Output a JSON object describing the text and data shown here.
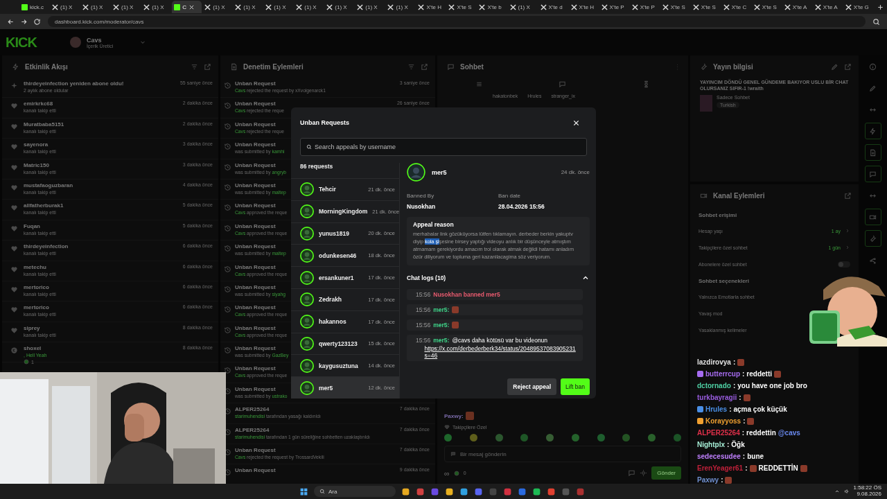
{
  "browser": {
    "tabs": [
      {
        "label": "kick.c",
        "kind": "kick",
        "selected": false
      },
      {
        "label": "(1) X",
        "kind": "x",
        "selected": false
      },
      {
        "label": "(1) X",
        "kind": "x",
        "selected": false
      },
      {
        "label": "(1) X",
        "kind": "x",
        "selected": false
      },
      {
        "label": "(1) X",
        "kind": "x",
        "selected": false
      },
      {
        "label": "C",
        "kind": "kick",
        "selected": true
      },
      {
        "label": "(1) X",
        "kind": "x",
        "selected": false
      },
      {
        "label": "(1) X",
        "kind": "x",
        "selected": false
      },
      {
        "label": "(1) X",
        "kind": "x",
        "selected": false
      },
      {
        "label": "(1) X",
        "kind": "x",
        "selected": false
      },
      {
        "label": "(1) X",
        "kind": "x",
        "selected": false
      },
      {
        "label": "(1) X",
        "kind": "x",
        "selected": false
      },
      {
        "label": "(1) X",
        "kind": "x",
        "selected": false
      },
      {
        "label": "X'te H",
        "kind": "x",
        "selected": false
      },
      {
        "label": "X'te S",
        "kind": "x",
        "selected": false
      },
      {
        "label": "X'te b",
        "kind": "x",
        "selected": false
      },
      {
        "label": "(1) X",
        "kind": "x",
        "selected": false
      },
      {
        "label": "X'te d",
        "kind": "x",
        "selected": false
      },
      {
        "label": "X'te H",
        "kind": "x",
        "selected": false
      },
      {
        "label": "X'te P",
        "kind": "x",
        "selected": false
      },
      {
        "label": "X'te P",
        "kind": "x",
        "selected": false
      },
      {
        "label": "X'te S",
        "kind": "x",
        "selected": false
      },
      {
        "label": "X'te S",
        "kind": "x",
        "selected": false
      },
      {
        "label": "X'te C",
        "kind": "x",
        "selected": false
      },
      {
        "label": "X'te S",
        "kind": "x",
        "selected": false
      },
      {
        "label": "X'te A",
        "kind": "x",
        "selected": false
      },
      {
        "label": "X'te A",
        "kind": "x",
        "selected": false
      },
      {
        "label": "X'te G",
        "kind": "x",
        "selected": false
      }
    ],
    "url": "dashboard.kick.com/moderator/cavs"
  },
  "header": {
    "logo": "KICK",
    "channel": "Cavs",
    "role": "İçerik Üretici"
  },
  "activity": {
    "title": "Etkinlik Akışı",
    "items": [
      {
        "kind": "resub",
        "name": "thirdeyeinfection yeniden abone oldu!",
        "detail": "2 aylık abone oldular",
        "time": "55 saniye önce"
      },
      {
        "kind": "follow",
        "name": "emirkrkc68",
        "detail": "kanalı takip etti",
        "time": "2 dakika önce"
      },
      {
        "kind": "follow",
        "name": "Muratbaba5151",
        "detail": "kanalı takip etti",
        "time": "2 dakika önce"
      },
      {
        "kind": "follow",
        "name": "sayenora",
        "detail": "kanalı takip etti",
        "time": "3 dakika önce"
      },
      {
        "kind": "follow",
        "name": "Matric150",
        "detail": "kanalı takip etti",
        "time": "3 dakika önce"
      },
      {
        "kind": "follow",
        "name": "mustafaoguzbaran",
        "detail": "kanalı takip etti",
        "time": "4 dakika önce"
      },
      {
        "kind": "follow",
        "name": "allfatherburak1",
        "detail": "kanalı takip etti",
        "time": "5 dakika önce"
      },
      {
        "kind": "follow",
        "name": "Fuqan",
        "detail": "kanalı takip etti",
        "time": "5 dakika önce"
      },
      {
        "kind": "follow",
        "name": "thirdeyeinfection",
        "detail": "kanalı takip etti",
        "time": "6 dakika önce"
      },
      {
        "kind": "follow",
        "name": "metechu",
        "detail": "kanalı takip etti",
        "time": "6 dakika önce"
      },
      {
        "kind": "follow",
        "name": "mertorico",
        "detail": "kanalı takip etti",
        "time": "6 dakika önce"
      },
      {
        "kind": "follow",
        "name": "mertorico",
        "detail": "kanalı takip etti",
        "time": "6 dakika önce"
      },
      {
        "kind": "follow",
        "name": "siprey",
        "detail": "kanalı takip etti",
        "time": "8 dakika önce"
      },
      {
        "kind": "gift",
        "name": "shoxel",
        "detail": ", Hell Yeah",
        "count": "1",
        "time": "8 dakika önce"
      }
    ]
  },
  "moderation": {
    "title": "Denetim Eylemleri",
    "items": [
      {
        "kind": "actor_first",
        "title": "Unban Request",
        "user": "Cavs",
        "text": "rejected the request by xXvolgenarck1",
        "time": "3 saniye önce"
      },
      {
        "kind": "actor_first",
        "title": "Unban Request",
        "user": "Cavs",
        "text": "rejected the reque",
        "time": "26 saniye önce"
      },
      {
        "kind": "actor_first",
        "title": "Unban Request",
        "user": "Cavs",
        "text": "rejected the reque"
      },
      {
        "kind": "actor_last",
        "title": "Unban Request",
        "user": "kamhi",
        "text": "was submitted by"
      },
      {
        "kind": "actor_last",
        "title": "Unban Request",
        "user": "angryb",
        "text": "was submitted by"
      },
      {
        "kind": "actor_last",
        "title": "Unban Request",
        "user": "maltep",
        "text": "was submitted by"
      },
      {
        "kind": "actor_first",
        "title": "Unban Request",
        "user": "Cavs",
        "text": "approved the reque"
      },
      {
        "kind": "actor_first",
        "title": "Unban Request",
        "user": "Cavs",
        "text": "approved the reque"
      },
      {
        "kind": "actor_last",
        "title": "Unban Request",
        "user": "maltep",
        "text": "was submitted by"
      },
      {
        "kind": "actor_first",
        "title": "Unban Request",
        "user": "Cavs",
        "text": "approved the reque"
      },
      {
        "kind": "actor_last",
        "title": "Unban Request",
        "user": "siyahg",
        "text": "was submitted by"
      },
      {
        "kind": "actor_first",
        "title": "Unban Request",
        "user": "Cavs",
        "text": "approved the reque"
      },
      {
        "kind": "actor_first",
        "title": "Unban Request",
        "user": "Cavs",
        "text": "approved the reque"
      },
      {
        "kind": "actor_last",
        "title": "Unban Request",
        "user": "GazBey",
        "text": "was submitted by"
      },
      {
        "kind": "actor_first",
        "title": "Unban Request",
        "user": "Cavs",
        "text": "approved the reque"
      },
      {
        "kind": "actor_last",
        "title": "Unban Request",
        "user": "ustrako",
        "text": "was submitted by"
      },
      {
        "kind": "actor_first",
        "title": "ALPER25264",
        "user": "starimuhendisi",
        "text": "tarafından yasağı kaldırıldı",
        "time": "7 dakika önce"
      },
      {
        "kind": "actor_first",
        "title": "ALPER25264",
        "user": "starimuhendisi",
        "text": "tarafından 1 gün süreliğine sohbetten uzaklaştırıldı",
        "time": "7 dakika önce"
      },
      {
        "kind": "actor_first",
        "title": "Unban Request",
        "user": "Cavs",
        "text": "rejected the request by TrossardVekili",
        "time": "7 dakika önce"
      },
      {
        "kind": "none",
        "title": "Unban Request",
        "time": "9 dakika önce"
      }
    ]
  },
  "chat": {
    "title": "Sohbet",
    "users": [
      "hakatonbek",
      "Hrules",
      "stranger_ix"
    ],
    "last_user": "Paxwy:",
    "followers_label": "Takipçilere Özel",
    "placeholder": "Bir mesaj gönderin",
    "infinity": "∞",
    "points": "0",
    "send": "Gönder"
  },
  "stream_info": {
    "title": "Yayın bilgisi",
    "stream_title": "YAYINCIM DÖNDÜ GENEL GÜNDEME BAKIYOR USLU BİR CHAT OLURSANIZ SIFIR-1 !wraith",
    "category": "Sadece Sohbet",
    "tag": "Turkish"
  },
  "channel": {
    "title": "Kanal Eylemleri",
    "sections": [
      {
        "heading": "Sohbet erişimi",
        "rows": [
          {
            "kind": "link",
            "label": "Hesap yaşı",
            "value": "1 ay"
          },
          {
            "kind": "link",
            "label": "Takipçilere özel sohbet",
            "value": "1 gün"
          },
          {
            "kind": "toggle",
            "label": "Abonelere özel sohbet",
            "on": false
          }
        ]
      },
      {
        "heading": "Sohbet seçenekleri",
        "rows": [
          {
            "kind": "plain",
            "label": "Yalnızca Emotlarla sohbet"
          },
          {
            "kind": "plain",
            "label": "Yavaş mod"
          },
          {
            "kind": "plain",
            "label": "Yasaklanmış kelimeler"
          }
        ]
      }
    ]
  },
  "tool_dock": [
    {
      "kind": "info",
      "active": false
    },
    {
      "kind": "pencil",
      "active": false
    },
    {
      "kind": "arrows",
      "active": false
    },
    {
      "kind": "bolt",
      "active": true
    },
    {
      "kind": "doc",
      "active": true
    },
    {
      "kind": "chat",
      "active": true
    },
    {
      "kind": "arrows",
      "active": false
    },
    {
      "kind": "camera",
      "active": true
    },
    {
      "kind": "wrench",
      "active": true
    },
    {
      "kind": "share",
      "active": false
    }
  ],
  "modal": {
    "title": "Unban Requests",
    "search_placeholder": "Search appeals by username",
    "count": "86 requests",
    "requests": [
      {
        "name": "Tehcir",
        "time": "21 dk. önce",
        "selected": false
      },
      {
        "name": "MorningKingdom",
        "time": "21 dk. önce",
        "selected": false
      },
      {
        "name": "yunus1819",
        "time": "20 dk. önce",
        "selected": false
      },
      {
        "name": "odunkesen46",
        "time": "18 dk. önce",
        "selected": false
      },
      {
        "name": "ersankuner1",
        "time": "17 dk. önce",
        "selected": false
      },
      {
        "name": "Zedrakh",
        "time": "17 dk. önce",
        "selected": false
      },
      {
        "name": "hakannos",
        "time": "17 dk. önce",
        "selected": false
      },
      {
        "name": "qwerty123123",
        "time": "15 dk. önce",
        "selected": false
      },
      {
        "name": "kaygusuztuna",
        "time": "14 dk. önce",
        "selected": false
      },
      {
        "name": "mer5",
        "time": "12 dk. önce",
        "selected": true
      }
    ],
    "detail": {
      "name": "mer5",
      "time": "24 dk. önce",
      "banned_by_label": "Banned By",
      "banned_by": "Nusokhan",
      "ban_date_label": "Ban date",
      "ban_date": "28.04.2026 15:56",
      "reason_label": "Appeal reason",
      "reason": [
        {
          "text": "merhabalar link gözüküyorsa lütfen tıklamayın. derbeder berkin yakuptv diyip ",
          "highlighted": false
        },
        {
          "text": "kola şi",
          "highlighted": true
        },
        {
          "text": "şesine birsey yaptığı videoyu anlık bir düşünceyle atmıştım atmamam gerekiyordu amacım trol olarak atmak değildi hatamı anladım özür diliyorum ve topluma geri kazanilacagima söz veriyorum.",
          "highlighted": false
        }
      ],
      "logs_label": "Chat logs (10)",
      "logs_expanded": true,
      "logs": [
        {
          "kind": "ban",
          "time": "15:56",
          "text": "Nusokhan banned mer5"
        },
        {
          "kind": "emote",
          "time": "15:56",
          "user": "mer5:"
        },
        {
          "kind": "emote",
          "time": "15:56",
          "user": "mer5:"
        },
        {
          "kind": "message",
          "time": "15:56",
          "user": "mer5:",
          "text": "@cavs daha kötüsü var bu videonun",
          "link": "https://x.com/derbederberk34/status/20489537083905231s=46"
        }
      ]
    },
    "reject": "Reject appeal",
    "lift": "Lift ban"
  },
  "overlay_chat": [
    {
      "name": "lazdirovya",
      "color": "#e4e4e4",
      "colon": ":",
      "badge": false,
      "lead_emote": false,
      "emote": true
    },
    {
      "name": "butterrcup",
      "color": "#a66cf0",
      "colon": ":",
      "badge": true,
      "lead_emote": false,
      "text": "reddetti",
      "emote": true
    },
    {
      "name": "dctornado",
      "color": "#4fd1a5",
      "colon": ":",
      "badge": false,
      "lead_emote": false,
      "text": "you have one job bro",
      "emote": false
    },
    {
      "name": "turkbayragii",
      "color": "#9a5ce0",
      "colon": ":",
      "badge": false,
      "lead_emote": false,
      "emote": true
    },
    {
      "name": "Hrules",
      "color": "#4a8fe6",
      "colon": ":",
      "badge": true,
      "lead_emote": false,
      "text": "açma çok küçük",
      "emote": false
    },
    {
      "name": "Korayyoss",
      "color": "#f0a030",
      "colon": ":",
      "badge": true,
      "lead_emote": false,
      "emote": true
    },
    {
      "name": "ALPER25264",
      "color": "#e0304a",
      "colon": ":",
      "badge": false,
      "lead_emote": false,
      "text": "reddettin",
      "mention": "@cavs",
      "emote": false
    },
    {
      "name": "Nightplx",
      "color": "#a8f0d8",
      "colon": ":",
      "badge": false,
      "lead_emote": false,
      "text": "Öğk",
      "emote": false
    },
    {
      "name": "sedecesudee",
      "color": "#c080ff",
      "colon": ":",
      "badge": false,
      "lead_emote": false,
      "text": "bune",
      "emote": false
    },
    {
      "name": "ErenYeager61",
      "color": "#c0203a",
      "colon": ":",
      "badge": false,
      "lead_emote": true,
      "text": "REDDETTİN",
      "emote": true
    },
    {
      "name": "Paxwy",
      "color": "#7090d0",
      "colon": ":",
      "badge": false,
      "lead_emote": false,
      "emote": true
    }
  ],
  "taskbar": {
    "search": "Ara",
    "time": "1:58:22 ÖS",
    "date": "9.08.2026"
  }
}
